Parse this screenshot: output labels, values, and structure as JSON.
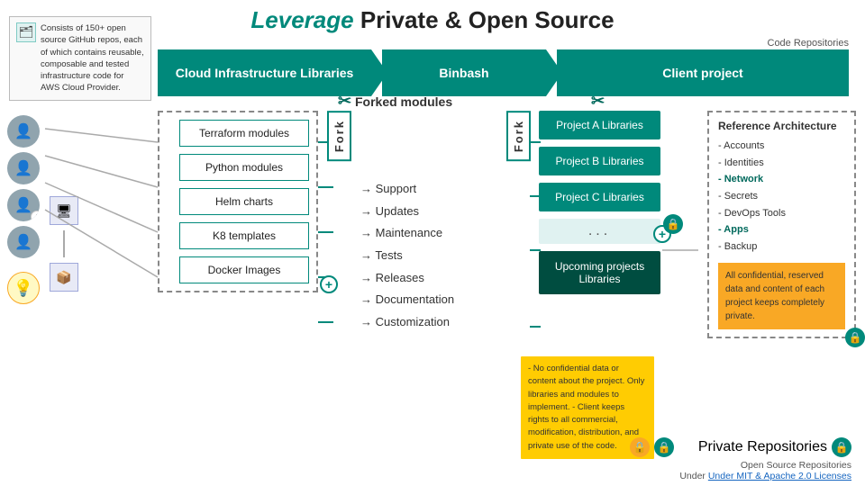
{
  "title": {
    "leverage": "Leverage",
    "rest": " Private & Open Source"
  },
  "code_repos_label": "Code  Repositories",
  "info_box": {
    "text": "Consists of 150+ open source GitHub repos, each of which contains reusable, composable and tested infrastructure code for AWS Cloud Provider."
  },
  "banner": {
    "seg1": "Cloud Infrastructure Libraries",
    "seg2": "Binbash",
    "seg3": "Client project"
  },
  "forked_modules_label": "Forked modules",
  "fork_label": "Fork",
  "modules": [
    "Terraform modules",
    "Python modules",
    "Helm charts",
    "K8 templates",
    "Docker Images"
  ],
  "actions": [
    "Support",
    "Updates",
    "Maintenance",
    "Tests",
    "Releases",
    "Documentation",
    "Customization"
  ],
  "projects": [
    "Project A Libraries",
    "Project B Libraries",
    "Project C Libraries",
    "...",
    "Upcoming projects Libraries"
  ],
  "ref_arch": {
    "title": "Reference Architecture",
    "items": [
      "- Accounts",
      "- Identities",
      "- Network",
      "- Secrets",
      "- DevOps Tools",
      "- Apps",
      "- Backup"
    ],
    "confidential": "All confidential, reserved data and content  of each project keeps completely private."
  },
  "upcoming_note": "- No confidential data or content about the project. Only libraries and modules to implement.\n- Client keeps rights to all commercial, modification, distribution, and private use of the code.",
  "bottom": {
    "private_label": "Private Repositories",
    "open_source_label": "Open Source Repositories",
    "license_label": "Under  MIT & Apache 2.0 Licenses"
  }
}
